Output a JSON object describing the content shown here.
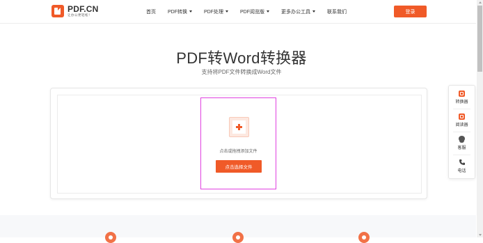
{
  "header": {
    "logo_name": "PDF.CN",
    "logo_slogan": "让办公更轻松！",
    "nav": [
      {
        "label": "首页",
        "has_dropdown": false
      },
      {
        "label": "PDF转换",
        "has_dropdown": true
      },
      {
        "label": "PDF处理",
        "has_dropdown": true
      },
      {
        "label": "PDF阅览版",
        "has_dropdown": true
      },
      {
        "label": "更多办公工具",
        "has_dropdown": true
      },
      {
        "label": "联系我们",
        "has_dropdown": false
      }
    ],
    "login_label": "登录"
  },
  "hero": {
    "title": "PDF转Word转换器",
    "subtitle": "支持将PDF文件转换成Word文件"
  },
  "upload": {
    "hint": "点击或拖拽添加文件",
    "button_label": "点击选择文件"
  },
  "float_bar": {
    "items": [
      {
        "label": "转换器",
        "icon": "converter-icon"
      },
      {
        "label": "阅读器",
        "icon": "reader-icon"
      },
      {
        "label": "客服",
        "icon": "customer-service-icon"
      },
      {
        "label": "电话",
        "icon": "phone-icon"
      }
    ]
  },
  "colors": {
    "accent": "#f05a28",
    "highlight_border": "#e040e0"
  }
}
